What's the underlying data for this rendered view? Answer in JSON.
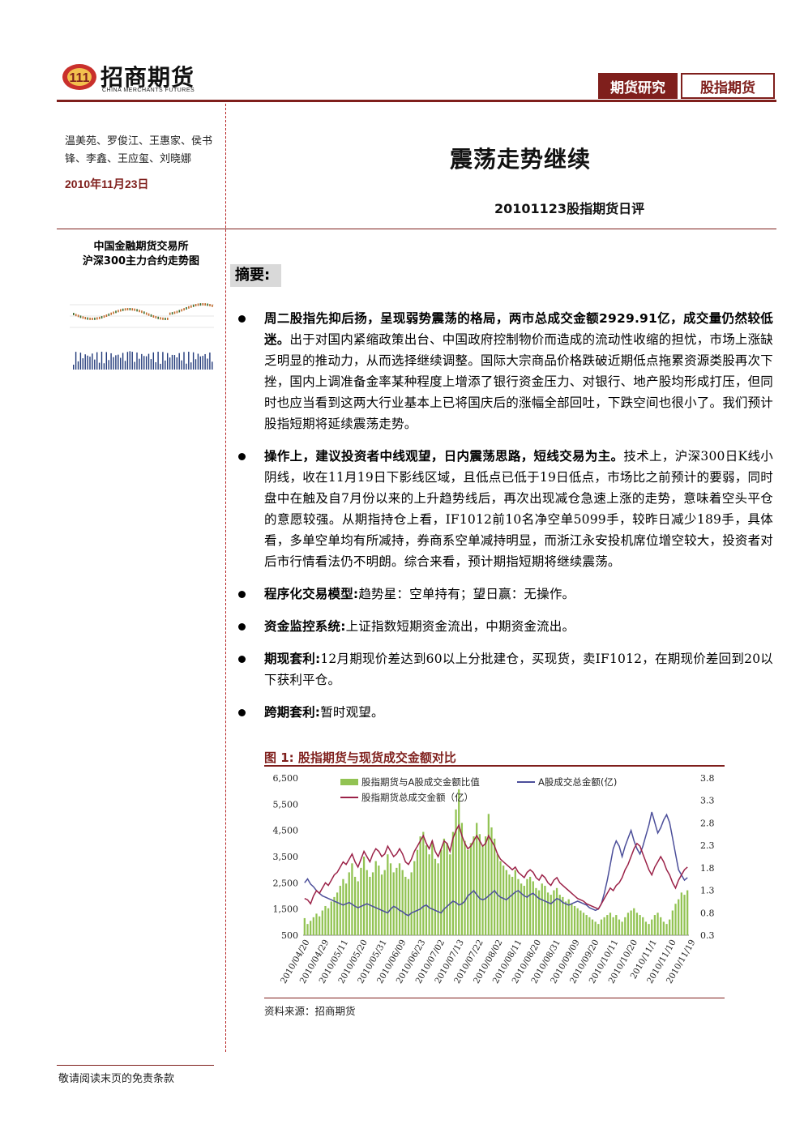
{
  "header": {
    "brand_cn": "招商期货",
    "brand_en": "CHINA MERCHANTS FUTURES",
    "tab_research": "期货研究",
    "tab_category": "股指期货"
  },
  "sidebar": {
    "authors": "温美苑、罗俊江、王惠家、侯书锋、李鑫、王应玺、刘晓娜",
    "date": "2010年11月23日",
    "mini_title_line1": "中国金融期货交易所",
    "mini_title_line2": "沪深300主力合约走势图"
  },
  "report": {
    "title": "震荡走势继续",
    "subtitle": "20101123股指期货日评",
    "summary_label": "摘要:"
  },
  "bullets": [
    {
      "bold": "周二股指先抑后扬，呈现弱势震荡的格局，两市总成交金额2929.91亿，成交量仍然较低迷。",
      "text": "出于对国内紧缩政策出台、中国政府控制物价而造成的流动性收缩的担忧，市场上涨缺乏明显的推动力，从而选择继续调整。国际大宗商品价格跌破近期低点拖累资源类股再次下挫，国内上调准备金率某种程度上增添了银行资金压力、对银行、地产股均形成打压，但同时也应当看到这两大行业基本上已将国庆后的涨幅全部回吐，下跌空间也很小了。我们预计股指短期将延续震荡走势。"
    },
    {
      "bold": "操作上，建议投资者中线观望，日内震荡思路，短线交易为主。",
      "text": "技术上，沪深300日K线小阴线，收在11月19日下影线区域，且低点已低于19日低点，市场比之前预计的要弱，同时盘中在触及自7月份以来的上升趋势线后，再次出现减仓急速上涨的走势，意味着空头平仓的意愿较强。从期指持仓上看，IF1012前10名净空单5099手，较昨日减少189手，具体看，多单空单均有所减持，券商系空单减持明显，而浙江永安投机席位增空较大，投资者对后市行情看法仍不明朗。综合来看，预计期指短期将继续震荡。"
    },
    {
      "bold": "程序化交易模型:",
      "text": "趋势星：空单持有；望日赢：无操作。"
    },
    {
      "bold": "资金监控系统:",
      "text": "上证指数短期资金流出，中期资金流出。"
    },
    {
      "bold": "期现套利:",
      "text": "12月期现价差达到60以上分批建仓，买现货，卖IF1012，在期现价差回到20以下获利平仓。"
    },
    {
      "bold": "跨期套利:",
      "text": "暂时观望。"
    }
  ],
  "figure": {
    "title": "图 1: 股指期货与现货成交金额对比",
    "source": "资料来源：招商期货"
  },
  "chart_data": {
    "type": "line",
    "title": "",
    "left_axis": {
      "ylim": [
        500,
        6500
      ],
      "ticks": [
        "6,500",
        "5,500",
        "4,500",
        "3,500",
        "2,500",
        "1,500",
        "500"
      ]
    },
    "right_axis": {
      "ylim": [
        0.3,
        3.8
      ],
      "ticks": [
        "3.8",
        "3.3",
        "2.8",
        "2.3",
        "1.8",
        "1.3",
        "0.8",
        "0.3"
      ]
    },
    "x_ticks": [
      "2010/04/20",
      "2010/04/29",
      "2010/05/11",
      "2010/05/20",
      "2010/05/31",
      "2010/06/09",
      "2010/06/23",
      "2010/07/02",
      "2010/07/13",
      "2010/07/22",
      "2010/08/02",
      "2010/08/11",
      "2010/08/20",
      "2010/08/31",
      "2010/09/09",
      "2010/09/20",
      "2010/10/11",
      "2010/10/20",
      "2010/11/1",
      "2010/11/10",
      "2010/11/19"
    ],
    "legend": [
      "股指期货与A股成交金额比值",
      "A股成交总金额(亿)",
      "股指期货总成交金额（亿）"
    ],
    "colors": {
      "ratio": "#92c353",
      "a_share": "#4c4f9a",
      "futures": "#9b2248"
    },
    "series": [
      {
        "name": "股指期货与A股成交金额比值",
        "axis": "right",
        "kind": "bar",
        "values": [
          0.68,
          0.55,
          0.62,
          0.7,
          0.78,
          0.72,
          0.85,
          0.95,
          0.9,
          1.05,
          1.15,
          1.25,
          1.4,
          1.55,
          1.45,
          1.7,
          1.9,
          1.6,
          1.5,
          1.8,
          2.05,
          1.75,
          1.6,
          1.7,
          1.95,
          1.85,
          1.65,
          1.75,
          2.1,
          1.9,
          1.7,
          1.8,
          1.9,
          1.75,
          1.6,
          1.55,
          1.7,
          1.95,
          2.2,
          2.5,
          2.6,
          2.3,
          2.1,
          2.4,
          2.0,
          1.9,
          2.2,
          2.45,
          2.35,
          2.1,
          2.6,
          3.1,
          3.55,
          2.8,
          2.4,
          2.2,
          2.35,
          2.5,
          2.8,
          2.55,
          2.3,
          2.5,
          3.0,
          2.7,
          2.45,
          2.1,
          1.95,
          1.85,
          1.75,
          1.65,
          1.6,
          1.75,
          1.55,
          1.45,
          1.4,
          1.55,
          1.6,
          1.5,
          1.35,
          1.3,
          1.45,
          1.4,
          1.25,
          1.2,
          1.3,
          1.35,
          1.2,
          1.15,
          1.05,
          1.1,
          1.0,
          0.95,
          0.9,
          0.85,
          0.8,
          0.75,
          0.7,
          0.65,
          0.6,
          0.55,
          0.65,
          0.7,
          0.75,
          0.8,
          0.7,
          0.75,
          0.65,
          0.6,
          0.7,
          0.8,
          0.85,
          0.9,
          0.8,
          0.75,
          0.7,
          0.6,
          0.55,
          0.65,
          0.75,
          0.8,
          0.7,
          0.6,
          0.55,
          0.65,
          0.85,
          1.0,
          1.1,
          1.25,
          1.2,
          1.3
        ]
      },
      {
        "name": "A股成交总金额(亿)",
        "axis": "left",
        "kind": "line",
        "values": [
          2500,
          2650,
          2450,
          2350,
          2200,
          2100,
          2000,
          1950,
          1900,
          1850,
          1800,
          1750,
          1700,
          1650,
          1700,
          1750,
          1680,
          1600,
          1550,
          1600,
          1650,
          1700,
          1650,
          1600,
          1550,
          1500,
          1450,
          1400,
          1350,
          1500,
          1600,
          1550,
          1450,
          1400,
          1300,
          1250,
          1350,
          1400,
          1450,
          1500,
          1600,
          1650,
          1550,
          1500,
          1450,
          1400,
          1350,
          1500,
          1600,
          1700,
          1800,
          1750,
          1650,
          1700,
          1800,
          2000,
          2100,
          2200,
          2050,
          1900,
          1850,
          1900,
          2000,
          2100,
          2200,
          2050,
          1950,
          1900,
          1850,
          1950,
          2050,
          2150,
          2200,
          2100,
          2000,
          1950,
          2050,
          2100,
          2000,
          1900,
          1850,
          1800,
          1750,
          1700,
          1800,
          1900,
          1850,
          1750,
          1700,
          1650,
          1700,
          1750,
          1800,
          1750,
          1700,
          1650,
          1550,
          1500,
          1450,
          1500,
          1700,
          2100,
          2600,
          3200,
          3800,
          4100,
          3900,
          3500,
          3900,
          4200,
          4500,
          4100,
          3800,
          3600,
          3900,
          4300,
          4700,
          5200,
          4800,
          4400,
          4600,
          4900,
          5100,
          4800,
          4200,
          3600,
          3000,
          2800,
          2600,
          2700
        ]
      },
      {
        "name": "股指期货总成交金额（亿）",
        "axis": "left",
        "kind": "line",
        "values": [
          1900,
          1850,
          1700,
          2000,
          2200,
          2100,
          2300,
          2500,
          2400,
          2600,
          2800,
          2900,
          3100,
          3300,
          3200,
          3400,
          3600,
          3300,
          3100,
          3400,
          3700,
          3500,
          3300,
          3600,
          3800,
          3700,
          3500,
          3600,
          3900,
          3700,
          3500,
          3600,
          3800,
          3600,
          3300,
          3200,
          3400,
          3700,
          3900,
          4100,
          4300,
          4000,
          3800,
          4100,
          3700,
          3500,
          3800,
          4100,
          4000,
          3700,
          4200,
          4500,
          4700,
          4300,
          4000,
          3800,
          3900,
          4100,
          4300,
          4100,
          3900,
          4000,
          4300,
          4100,
          3900,
          3600,
          3400,
          3300,
          3200,
          3100,
          3000,
          3100,
          2900,
          2800,
          2700,
          2900,
          3000,
          2900,
          2700,
          2600,
          2800,
          2700,
          2500,
          2400,
          2600,
          2700,
          2500,
          2400,
          2300,
          2200,
          2100,
          2000,
          1900,
          1850,
          1800,
          1700,
          1650,
          1600,
          1550,
          1500,
          1700,
          1900,
          2100,
          2300,
          2200,
          2400,
          2500,
          2700,
          3000,
          3200,
          3500,
          3800,
          4000,
          3900,
          3600,
          3300,
          3000,
          2800,
          3100,
          3300,
          3500,
          3300,
          3000,
          2800,
          2500,
          2300,
          2600,
          2800,
          3000,
          3100
        ]
      }
    ]
  },
  "footer": {
    "disclaimer": "敬请阅读末页的免责条款"
  }
}
